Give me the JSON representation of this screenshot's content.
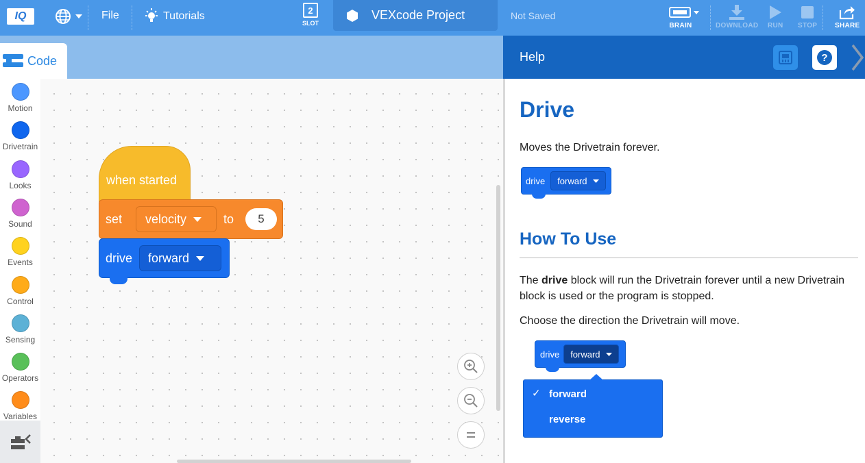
{
  "topbar": {
    "logo": "IQ",
    "file": "File",
    "tutorials": "Tutorials",
    "slot_number": "2",
    "slot_label": "SLOT",
    "project_name": "VEXcode Project",
    "save_status": "Not Saved",
    "brain": "BRAIN",
    "download": "DOWNLOAD",
    "run": "RUN",
    "stop": "STOP",
    "share": "SHARE"
  },
  "code_tab": {
    "label": "Code"
  },
  "categories": [
    {
      "name": "Motion",
      "color": "#4c97ff"
    },
    {
      "name": "Drivetrain",
      "color": "#0f66ee"
    },
    {
      "name": "Looks",
      "color": "#9966ff"
    },
    {
      "name": "Sound",
      "color": "#cf63cf"
    },
    {
      "name": "Events",
      "color": "#ffd21e"
    },
    {
      "name": "Control",
      "color": "#ffab19"
    },
    {
      "name": "Sensing",
      "color": "#5cb1d6"
    },
    {
      "name": "Operators",
      "color": "#59c059"
    },
    {
      "name": "Variables",
      "color": "#ff8c1a"
    }
  ],
  "blocks": {
    "hat": "when started",
    "set": {
      "label": "set",
      "dropdown": "velocity",
      "to": "to",
      "value": "5"
    },
    "drive": {
      "label": "drive",
      "dropdown": "forward"
    }
  },
  "help": {
    "header": "Help",
    "title": "Drive",
    "description": "Moves the Drivetrain forever.",
    "example_block": {
      "label": "drive",
      "dropdown": "forward"
    },
    "howto_heading": "How To Use",
    "para1_pre": "The ",
    "para1_bold": "drive",
    "para1_post": " block will run the Drivetrain forever until a new Drivetrain block is used or the program is stopped.",
    "para2": "Choose the direction the Drivetrain will move.",
    "dropdown_block": {
      "label": "drive",
      "dropdown": "forward"
    },
    "menu": {
      "checkmark": "✓",
      "options": [
        "forward",
        "reverse"
      ]
    }
  },
  "colors": {
    "topbar": "#4a98e8",
    "help_header": "#1565c0",
    "drive_block": "#1a6ff0",
    "set_block": "#f7892c",
    "hat_block": "#f7bb2b"
  }
}
